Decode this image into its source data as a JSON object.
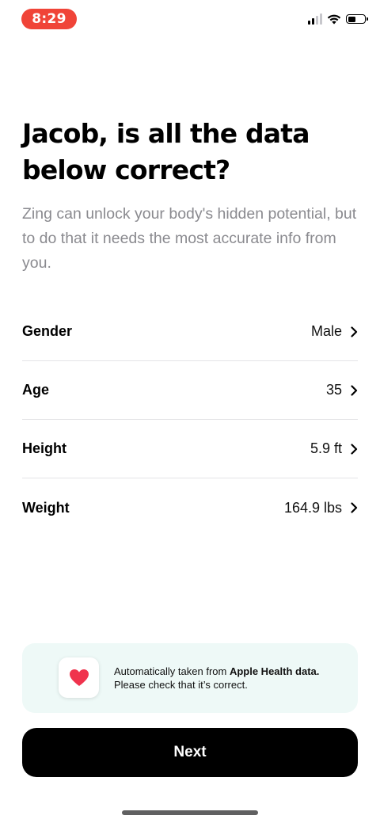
{
  "status_bar": {
    "time": "8:29",
    "signal_icon": "cellular-signal-icon",
    "wifi_icon": "wifi-icon",
    "battery_icon": "battery-icon",
    "battery_level": 0.5,
    "time_pill_color": "#f04438"
  },
  "header": {
    "title": "Jacob, is all the data below correct?",
    "subtitle": "Zing can unlock your body's hidden potential, but to do that it needs the most accurate info from you."
  },
  "data_rows": [
    {
      "label": "Gender",
      "value": "Male"
    },
    {
      "label": "Age",
      "value": "35"
    },
    {
      "label": "Height",
      "value": "5.9 ft"
    },
    {
      "label": "Weight",
      "value": "164.9 lbs"
    }
  ],
  "health_notice": {
    "icon": "heart-icon",
    "line1_prefix": "Automatically taken from ",
    "line1_bold": "Apple Health data.",
    "line2": "Please check that it’s correct.",
    "background_color": "#eef9f7",
    "heart_color": "#f0334d"
  },
  "footer": {
    "next_label": "Next",
    "button_color": "#000000"
  }
}
